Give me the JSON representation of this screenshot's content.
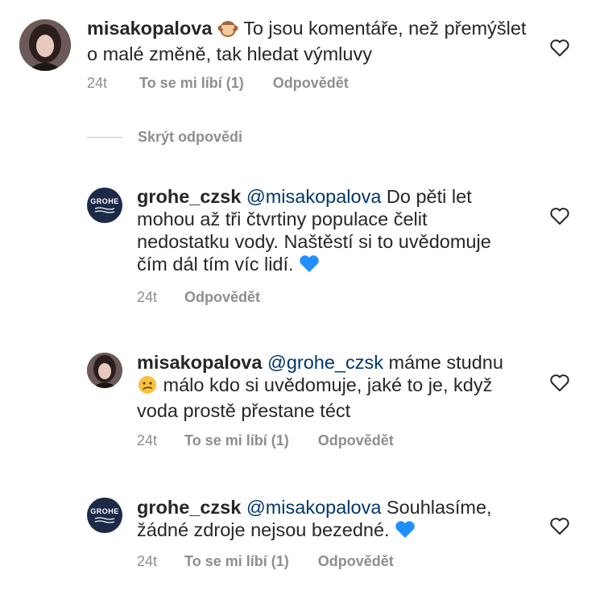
{
  "comments": [
    {
      "username": "misakopalova",
      "emoji": "monkey-face-emoji",
      "text": " To jsou komentáře, než přemýšlet o malé změně, tak hledat výmluvy",
      "time": "24t",
      "likes_label": "To se mi líbí (1)",
      "reply_label": "Odpovědět"
    },
    {
      "username": "grohe_czsk",
      "mention": "@misakopalova",
      "text": " Do pěti let mohou až tři čtvrtiny populace čelit nedostatku vody. Naštěstí si to uvědomuje čím dál tím víc lidí.",
      "emoji": "blue-heart-emoji",
      "time": "24t",
      "reply_label": "Odpovědět"
    },
    {
      "username": "misakopalova",
      "mention": "@grohe_czsk",
      "text_before": " máme studnu ",
      "emoji": "confused-face-emoji",
      "text_after": " málo kdo si uvědomuje, jaké to je, když voda prostě přestane téct",
      "time": "24t",
      "likes_label": "To se mi líbí (1)",
      "reply_label": "Odpovědět"
    },
    {
      "username": "grohe_czsk",
      "mention": "@misakopalova",
      "text": " Souhlasíme, žádné zdroje nejsou bezedné.",
      "emoji": "blue-heart-emoji",
      "time": "24t",
      "likes_label": "To se mi líbí (1)",
      "reply_label": "Odpovědět"
    }
  ],
  "hide_replies_label": "Skrýt odpovědi",
  "brand_logo_text": "GROHE",
  "colors": {
    "text": "#262626",
    "secondary": "#8e8e8e",
    "mention": "#00376b",
    "brand_avatar": "#1c2a48",
    "blue_heart": "#1f8fff"
  }
}
